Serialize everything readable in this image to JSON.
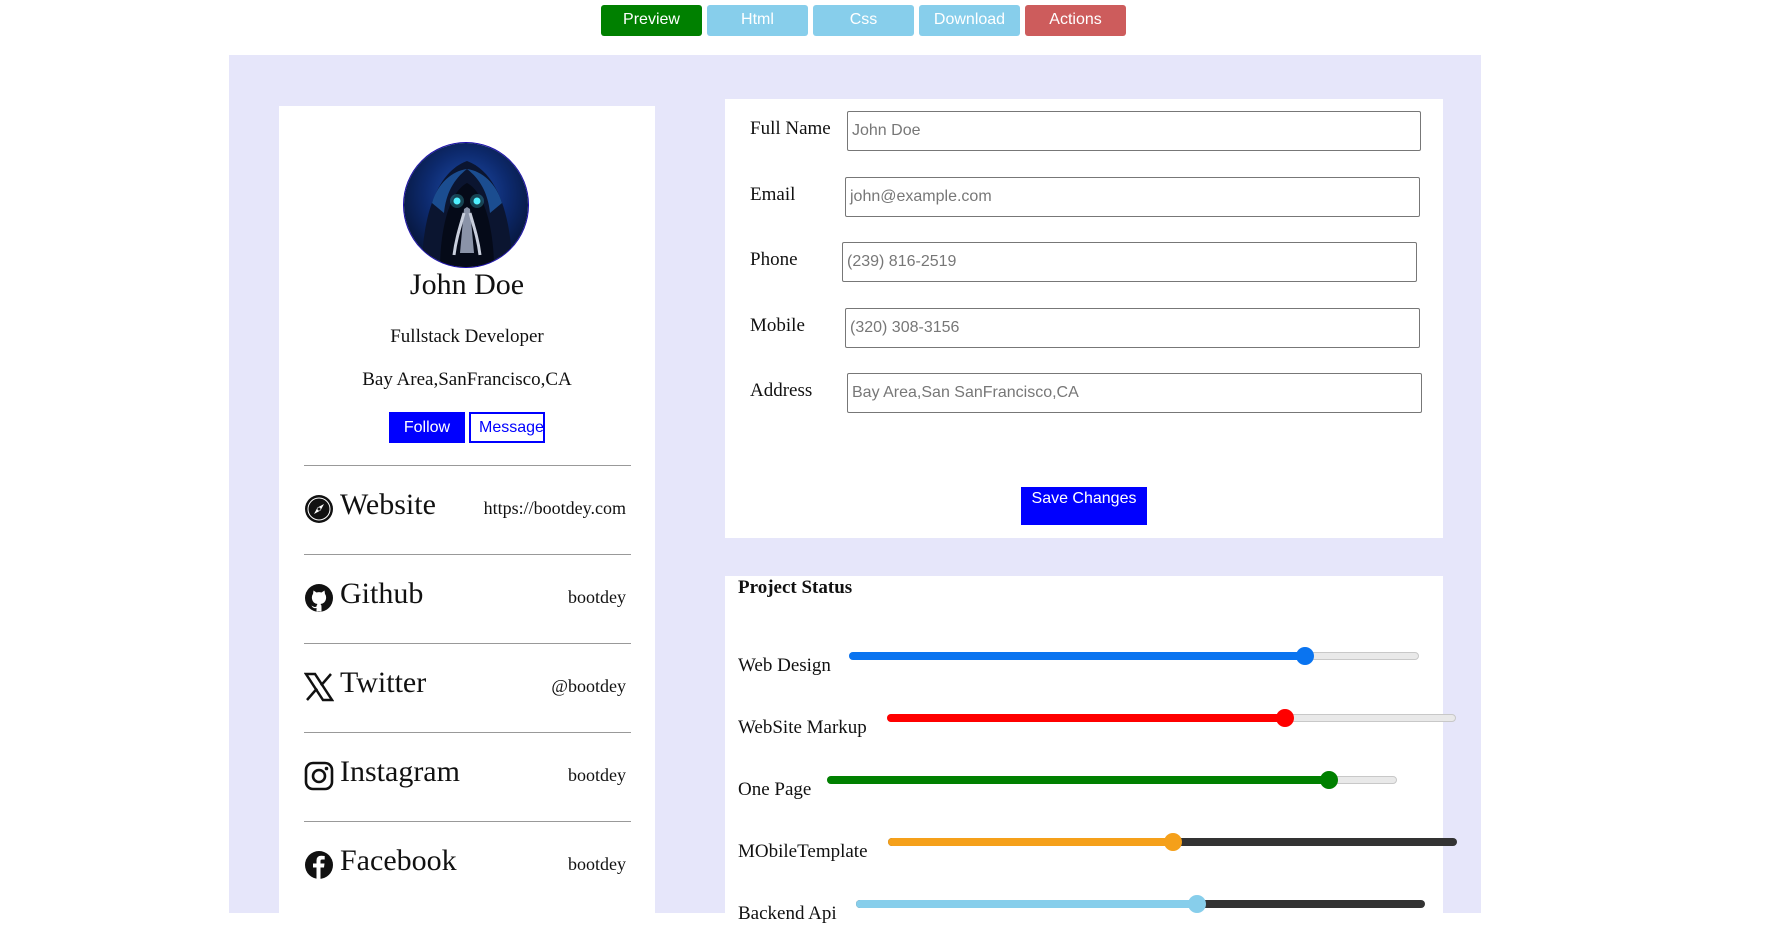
{
  "toolbar": {
    "buttons": [
      {
        "label": "Preview",
        "color": "#008000"
      },
      {
        "label": "Html",
        "color": "#87ceeb"
      },
      {
        "label": "Css",
        "color": "#87ceeb"
      },
      {
        "label": "Download",
        "color": "#87ceeb"
      },
      {
        "label": "Actions",
        "color": "#cd5c5c"
      }
    ]
  },
  "profile": {
    "name": "John Doe",
    "role": "Fullstack Developer",
    "location": "Bay Area,SanFrancisco,CA",
    "follow_label": "Follow",
    "message_label": "Message",
    "links": [
      {
        "icon": "compass-icon",
        "name": "Website",
        "value": "https://bootdey.com"
      },
      {
        "icon": "github-icon",
        "name": "Github",
        "value": "bootdey"
      },
      {
        "icon": "x-twitter-icon",
        "name": "Twitter",
        "value": "@bootdey"
      },
      {
        "icon": "instagram-icon",
        "name": "Instagram",
        "value": "bootdey"
      },
      {
        "icon": "facebook-icon",
        "name": "Facebook",
        "value": "bootdey"
      }
    ]
  },
  "form": {
    "fields": [
      {
        "label": "Full Name",
        "placeholder": "John Doe"
      },
      {
        "label": "Email",
        "placeholder": "john@example.com"
      },
      {
        "label": "Phone",
        "placeholder": "(239) 816-2519"
      },
      {
        "label": "Mobile",
        "placeholder": "(320) 308-3156"
      },
      {
        "label": "Address",
        "placeholder": "Bay Area,San SanFrancisco,CA"
      }
    ],
    "save_label": "Save Changes"
  },
  "project_status": {
    "title": "Project Status",
    "items": [
      {
        "label": "Web Design",
        "value": 80,
        "color": "#0a74f0"
      },
      {
        "label": "WebSite Markup",
        "value": 70,
        "color": "#ff0000"
      },
      {
        "label": "One Page",
        "value": 88,
        "color": "#008000"
      },
      {
        "label": "MObileTemplate",
        "value": 50,
        "color": "#f5a01a"
      },
      {
        "label": "Backend Api",
        "value": 60,
        "color": "#87ceeb"
      }
    ]
  },
  "colors": {
    "panel": "#e6e6fa",
    "primary": "#0000ff"
  }
}
